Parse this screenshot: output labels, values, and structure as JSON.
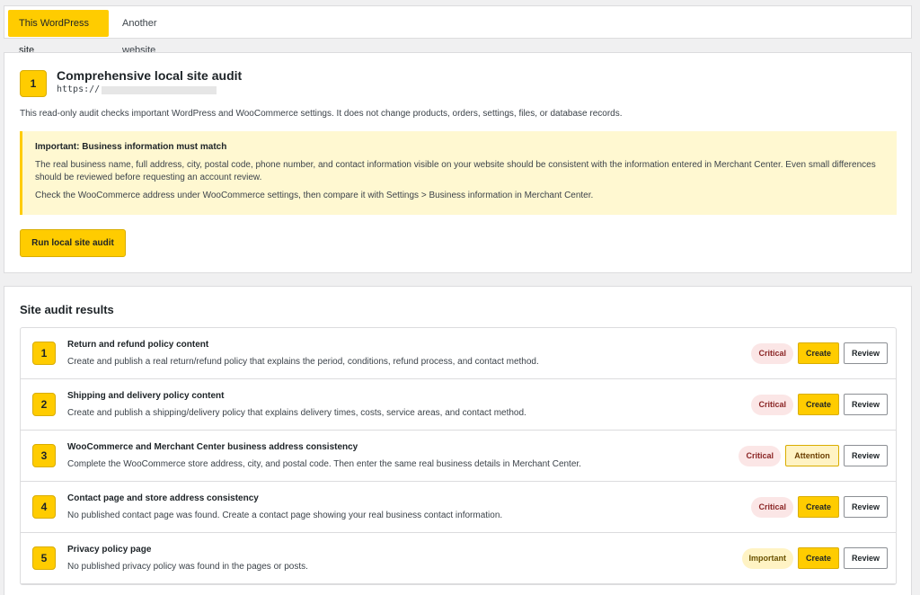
{
  "tabs": [
    {
      "label": "This WordPress site",
      "active": true
    },
    {
      "label": "Another website",
      "active": false
    }
  ],
  "audit": {
    "number": "1",
    "title": "Comprehensive local site audit",
    "url": "https://",
    "description": "This read-only audit checks important WordPress and WooCommerce settings. It does not change products, orders, settings, files, or database records.",
    "notice": {
      "title": "Important: Business information must match",
      "text1": "The real business name, full address, city, postal code, phone number, and contact information visible on your website should be consistent with the information entered in Merchant Center. Even small differences should be reviewed before requesting an account review.",
      "text2": "Check the WooCommerce address under WooCommerce settings, then compare it with Settings > Business information in Merchant Center."
    },
    "run_button": "Run local site audit"
  },
  "results": {
    "title": "Site audit results",
    "items": [
      {
        "number": "1",
        "title": "Return and refund policy content",
        "description": "Create and publish a real return/refund policy that explains the period, conditions, refund process, and contact method.",
        "severity": "Critical",
        "action": "Create",
        "review": "Review"
      },
      {
        "number": "2",
        "title": "Shipping and delivery policy content",
        "description": "Create and publish a shipping/delivery policy that explains delivery times, costs, service areas, and contact method.",
        "severity": "Critical",
        "action": "Create",
        "review": "Review"
      },
      {
        "number": "3",
        "title": "WooCommerce and Merchant Center business address consistency",
        "description": "Complete the WooCommerce store address, city, and postal code. Then enter the same real business details in Merchant Center.",
        "severity": "Critical",
        "action": "Attention",
        "review": "Review"
      },
      {
        "number": "4",
        "title": "Contact page and store address consistency",
        "description": "No published contact page was found. Create a contact page showing your real business contact information.",
        "severity": "Critical",
        "action": "Create",
        "review": "Review"
      },
      {
        "number": "5",
        "title": "Privacy policy page",
        "description": "No published privacy policy was found in the pages or posts.",
        "severity": "Important",
        "action": "Create",
        "review": "Review"
      }
    ]
  },
  "colors": {
    "accent": "#ffcc00",
    "critical_bg": "#fbe6e6",
    "important_bg": "#fff3c4",
    "notice_bg": "#fff8d1"
  }
}
